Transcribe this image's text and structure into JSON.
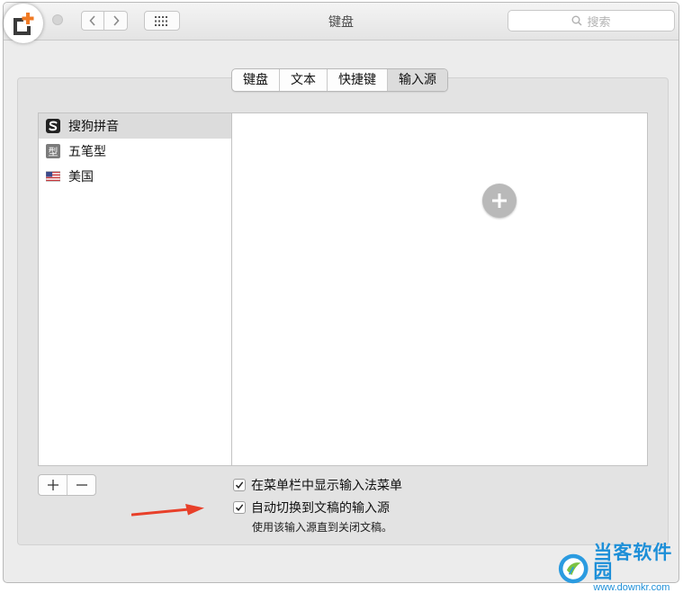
{
  "window": {
    "title": "键盘"
  },
  "search": {
    "placeholder": "搜索"
  },
  "tabs": [
    {
      "label": "键盘",
      "active": false
    },
    {
      "label": "文本",
      "active": false
    },
    {
      "label": "快捷键",
      "active": false
    },
    {
      "label": "输入源",
      "active": true
    }
  ],
  "input_sources": [
    {
      "label": "搜狗拼音",
      "icon": "sogou-s-icon",
      "selected": true
    },
    {
      "label": "五笔型",
      "icon": "wubi-icon",
      "icon_char": "型",
      "selected": false
    },
    {
      "label": "美国",
      "icon": "us-flag-icon",
      "selected": false
    }
  ],
  "controls": {
    "add_label": "+",
    "remove_label": "−"
  },
  "options": {
    "show_menu_label": "在菜单栏中显示输入法菜单",
    "show_menu_checked": true,
    "auto_switch_label": "自动切换到文稿的输入源",
    "auto_switch_checked": true,
    "auto_switch_note": "使用该输入源直到关闭文稿。"
  },
  "watermark": {
    "name": "当客软件园",
    "url": "www.downkr.com"
  },
  "colors": {
    "arrow": "#e8402a",
    "logo_accent": "#f07a24",
    "watermark": "#1d8fd8"
  }
}
